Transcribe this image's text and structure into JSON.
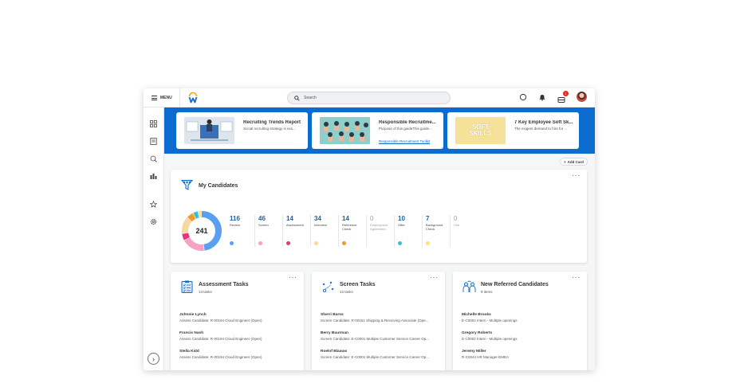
{
  "topbar": {
    "menu_label": "MENU",
    "search_placeholder": "Search",
    "notification_count": "1"
  },
  "banner": {
    "cards": [
      {
        "title": "Recruiting Trends Report",
        "description": "Social recruiting strategy is ess...",
        "link": ""
      },
      {
        "title": "Responsible Recruitme...",
        "description": "Purpose of this guideThis guide...",
        "link": "Responsible Recruitment Toolkit"
      },
      {
        "title": "7 Key Employee Soft Sk...",
        "description": "The exigent demand to hire for ...",
        "link": ""
      }
    ],
    "soft_skills_line1": "SOFT",
    "soft_skills_line2": "SKILLS"
  },
  "add_card_label": "Add Card",
  "my_candidates": {
    "title": "My Candidates",
    "total": "241",
    "stages": [
      {
        "count": "116",
        "label": "Review",
        "color": "#5b9ff0",
        "muted": false
      },
      {
        "count": "46",
        "label": "Screen",
        "color": "#f7a1c4",
        "muted": false
      },
      {
        "count": "14",
        "label": "Assessment",
        "color": "#e8357a",
        "muted": false
      },
      {
        "count": "34",
        "label": "Interview",
        "color": "#f7d8a0",
        "muted": false
      },
      {
        "count": "14",
        "label": "Reference Check",
        "color": "#f29a25",
        "muted": false
      },
      {
        "count": "0",
        "label": "Employment Agreement",
        "color": "",
        "muted": true
      },
      {
        "count": "10",
        "label": "Offer",
        "color": "#31c0d6",
        "muted": false
      },
      {
        "count": "7",
        "label": "Background Check",
        "color": "#f7e38a",
        "muted": false
      },
      {
        "count": "0",
        "label": "Hire",
        "color": "",
        "muted": true
      }
    ]
  },
  "assessment_tasks": {
    "title": "Assessment Tasks",
    "subtitle": "14 tasks",
    "rows": [
      {
        "name": "Johnnie Lynch",
        "desc": "Assess Candidate: R-00194 Cloud Engineer (Open)"
      },
      {
        "name": "Francis Nash",
        "desc": "Assess Candidate: R-00194 Cloud Engineer (Open)"
      },
      {
        "name": "Stella Kidd",
        "desc": "Assess Candidate: R-00194 Cloud Engineer (Open)"
      }
    ]
  },
  "screen_tasks": {
    "title": "Screen Tasks",
    "subtitle": "13 tasks",
    "rows": [
      {
        "name": "Sherri Barns",
        "desc": "Screen Candidate: R-00151 Shipping & Receiving Associate (Ope..."
      },
      {
        "name": "Berry Buurman",
        "desc": "Screen Candidate: E-C0001 Multiple Customer Service Career Op..."
      },
      {
        "name": "Roelof Blaauw",
        "desc": "Screen Candidate: E-C0001 Multiple Customer Service Career Op..."
      }
    ]
  },
  "referred_candidates": {
    "title": "New Referred Candidates",
    "subtitle": "9 items",
    "rows": [
      {
        "name": "Michelle Brooks",
        "desc": "E-C0002 Intern - Multiple openings"
      },
      {
        "name": "Gregory Roberts",
        "desc": "E-C0002 Intern - Multiple openings"
      },
      {
        "name": "Jeremy Miller",
        "desc": "R-C0044 HR Manager-EMEA"
      }
    ]
  }
}
